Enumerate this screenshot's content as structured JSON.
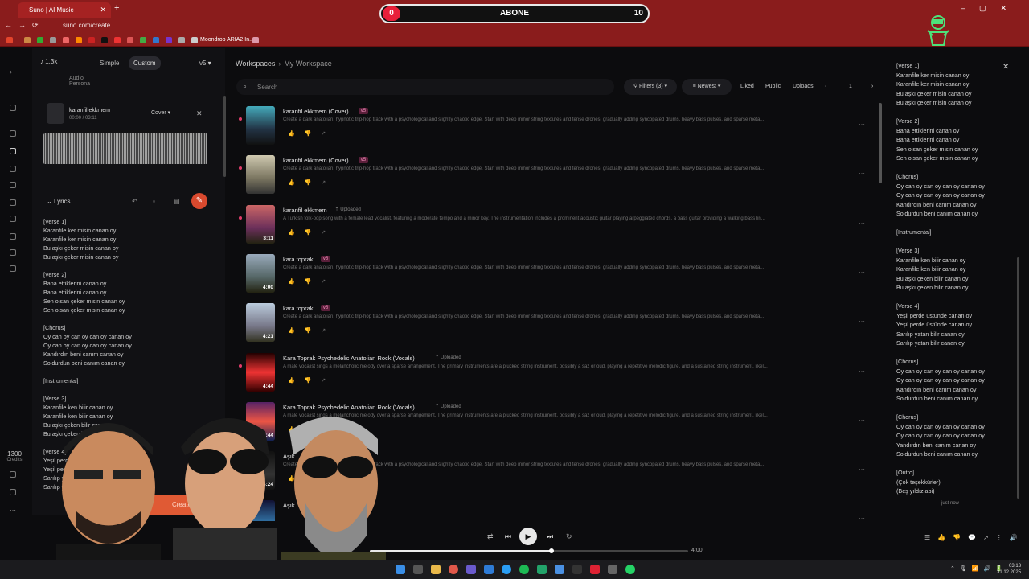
{
  "browser": {
    "tab_title": "Suno | AI Music",
    "url": "suno.com/create",
    "bookmark_label": "Moondrop ARIA2 In..."
  },
  "stream_overlay": {
    "left_count": "0",
    "label": "ABONE",
    "right_count": "10"
  },
  "left_panel": {
    "credits_count": "1.3k",
    "mode_simple": "Simple",
    "mode_custom": "Custom",
    "version": "v5",
    "tab_audio": "Audio",
    "tab_persona": "Persona",
    "song_name": "karanfil ekkmem",
    "song_time": "00:00 / 03:11",
    "cover_label": "Cover",
    "lyrics_label": "Lyrics",
    "create_label": "Create",
    "lyrics": [
      "[Verse 1]",
      "Karanfile ker misin canan oy",
      "Karanfile ker misin canan oy",
      "Bu aşkı çeker misin canan oy",
      "Bu aşkı çeker misin canan oy",
      "",
      "[Verse 2]",
      "Bana ettiklerini canan oy",
      "Bana ettiklerini canan oy",
      "Sen olsan çeker misin canan oy",
      "Sen olsan çeker misin canan oy",
      "",
      "[Chorus]",
      "Oy can oy can oy can oy canan oy",
      "Oy can oy can oy can oy canan oy",
      "Kandırdın beni canım canan oy",
      "Soldurdun beni canım canan oy",
      "",
      "[Instrumental]",
      "",
      "[Verse 3]",
      "Karanfile ken bilir canan oy",
      "Karanfile ken bilir canan oy",
      "Bu aşkı çeken bilir canan oy",
      "Bu aşkı çeken bilir canan oy",
      "",
      "[Verse 4]",
      "Yeşil perde",
      "Yeşil perde",
      "Sarılıp yatan",
      "Sarılıp yatan"
    ]
  },
  "sidebar": {
    "credits_value": "1300",
    "credits_label": "Credits"
  },
  "main": {
    "breadcrumb_root": "Workspaces",
    "breadcrumb_current": "My Workspace",
    "search_placeholder": "Search",
    "filters_label": "Filters (3)",
    "sort_label": "Newest",
    "liked_label": "Liked",
    "public_label": "Public",
    "uploads_label": "Uploads",
    "page_number": "1",
    "rows": [
      {
        "title": "karanfil ekkmem (Cover)",
        "badge": "v5",
        "uploaded": "",
        "duration": "",
        "desc": "Create a dark anatolian, hypnotic trip-hop track with a psychological and slightly chaotic edge. Start with deep minor string textures and tense drones, gradually adding syncopated drums, heavy bass pulses, and sparse meta..."
      },
      {
        "title": "karanfil ekkmem (Cover)",
        "badge": "v5",
        "uploaded": "",
        "duration": "",
        "desc": "Create a dark anatolian, hypnotic trip-hop track with a psychological and slightly chaotic edge. Start with deep minor string textures and tense drones, gradually adding syncopated drums, heavy bass pulses, and sparse meta..."
      },
      {
        "title": "karanfil ekkmem",
        "badge": "",
        "uploaded": "Uploaded",
        "duration": "3:11",
        "desc": "A Turkish folk-pop song with a female lead vocalist, featuring a moderate tempo and a minor key. The instrumentation includes a prominent acoustic guitar playing arpeggiated chords, a bass guitar providing a walking bass lin..."
      },
      {
        "title": "kara toprak",
        "badge": "v5",
        "uploaded": "",
        "duration": "4:00",
        "desc": "Create a dark anatolian, hypnotic trip-hop track with a psychological and slightly chaotic edge. Start with deep minor string textures and tense drones, gradually adding syncopated drums, heavy bass pulses, and sparse meta..."
      },
      {
        "title": "kara toprak",
        "badge": "v5",
        "uploaded": "",
        "duration": "4:21",
        "desc": "Create a dark anatolian, hypnotic trip-hop track with a psychological and slightly chaotic edge. Start with deep minor string textures and tense drones, gradually adding syncopated drums, heavy bass pulses, and sparse meta..."
      },
      {
        "title": "Kara Toprak Psychedelic Anatolian Rock (Vocals)",
        "badge": "",
        "uploaded": "Uploaded",
        "duration": "4:44",
        "desc": "A male vocalist sings a melancholic melody over a sparse arrangement. The primary instruments are a plucked string instrument, possibly a saz or oud, playing a repetitive melodic figure, and a sustained string instrument, likel..."
      },
      {
        "title": "Kara Toprak Psychedelic Anatolian Rock (Vocals)",
        "badge": "",
        "uploaded": "Uploaded",
        "duration": "4:44",
        "desc": "A male vocalist sings a melancholic melody over a sparse arrangement. The primary instruments are a plucked string instrument, possibly a saz or oud, playing a repetitive melodic figure, and a sustained string instrument, likel..."
      },
      {
        "title": "Aşık ... Arşiv (Cover)",
        "badge": "v5",
        "uploaded": "",
        "duration": "4:24",
        "desc": "Create a dark anatolian, hypnotic trip-hop track with a psychological and slightly chaotic edge. Start with deep minor string textures and tense drones, gradually adding syncopated drums, heavy bass pulses, and sparse meta..."
      },
      {
        "title": "Aşık ... Arşiv (Cover)",
        "badge": "v5",
        "uploaded": "",
        "duration": "",
        "desc": ""
      }
    ]
  },
  "right_panel": {
    "lyrics": [
      "[Verse 1]",
      "Karanfile ker misin canan oy",
      "Karanfile ker misin canan oy",
      "Bu aşkı çeker misin canan oy",
      "Bu aşkı çeker misin canan oy",
      "",
      "[Verse 2]",
      "Bana ettiklerini canan oy",
      "Bana ettiklerini canan oy",
      "Sen olsan çeker misin canan oy",
      "Sen olsan çeker misin canan oy",
      "",
      "[Chorus]",
      "Oy can oy can oy can oy canan oy",
      "Oy can oy can oy can oy canan oy",
      "Kandırdın beni canım canan oy",
      "Soldurdun beni canım canan oy",
      "",
      "[Instrumental]",
      "",
      "[Verse 3]",
      "Karanfile ken bilir canan oy",
      "Karanfile ken bilir canan oy",
      "Bu aşkı çeken bilir canan oy",
      "Bu aşkı çeken bilir canan oy",
      "",
      "[Verse 4]",
      "Yeşil perde üstünde canan oy",
      "Yeşil perde üstünde canan oy",
      "Sarılıp yatan bilir canan oy",
      "Sarılıp yatan bilir canan oy",
      "",
      "[Chorus]",
      "Oy can oy can oy can oy canan oy",
      "Oy can oy can oy can oy canan oy",
      "Kandırdın beni canım canan oy",
      "Soldurdun beni canım canan oy",
      "",
      "[Chorus]",
      "Oy can oy can oy can oy canan oy",
      "Oy can oy can oy can oy canan oy",
      "Yandırdın beni canım canan oy",
      "Soldurdun beni canım canan oy",
      "",
      "[Outro]",
      "(Çok teşekkürler)",
      "(Beş yıldız abi)"
    ],
    "timestamp": "just now"
  },
  "player": {
    "time": "4:00",
    "progress": 0.57
  },
  "taskbar": {
    "time": "03:13",
    "date": "31.12.2025"
  },
  "colors": {
    "browser_red": "#8a1c1c",
    "accent_orange": "#e05a34",
    "badge_pink": "#f08bb8",
    "live_dot": "#e23c6a"
  }
}
